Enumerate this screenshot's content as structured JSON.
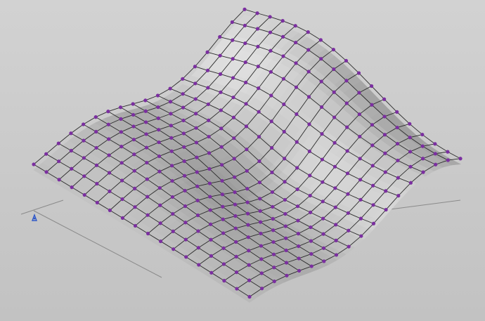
{
  "viewport": {
    "background": "#c9c9c9",
    "surface_color": "#b8b8b8",
    "mesh_line_color": "#2a2a2a",
    "control_point_color": "#7b2fa0",
    "axis_color": "#8a8a8a",
    "origin_marker_color": "#2f58c8"
  },
  "scene": {
    "object_type": "surface-with-control-net",
    "grid_rows": 18,
    "grid_cols": 18
  },
  "icons": {
    "origin": "ucs-origin-icon"
  }
}
